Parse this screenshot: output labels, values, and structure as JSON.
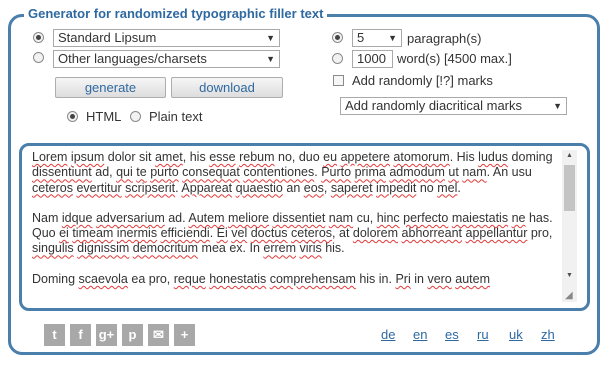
{
  "form": {
    "legend": "Generator for randomized typographic filler text",
    "source_select_1": "Standard Lipsum",
    "source_select_2": "Other languages/charsets",
    "generate_label": "generate",
    "download_label": "download",
    "format_html": "HTML",
    "format_plain": "Plain text",
    "paragraphs_value": "5",
    "paragraphs_label": "paragraph(s)",
    "words_value": "1000",
    "words_label": "word(s) [4500 max.]",
    "random_marks_label": "Add randomly [!?] marks",
    "diacritical_select": "Add randomly diacritical marks"
  },
  "output": {
    "p1": [
      {
        "t": "Lorem",
        "s": true
      },
      {
        "t": " "
      },
      {
        "t": "ipsum",
        "s": true
      },
      {
        "t": " dolor sit "
      },
      {
        "t": "amet",
        "s": true
      },
      {
        "t": ", his "
      },
      {
        "t": "esse",
        "s": true
      },
      {
        "t": " "
      },
      {
        "t": "rebum",
        "s": true
      },
      {
        "t": " no, duo "
      },
      {
        "t": "eu",
        "s": true
      },
      {
        "t": " "
      },
      {
        "t": "appetere",
        "s": true
      },
      {
        "t": " "
      },
      {
        "t": "atomorum",
        "s": true
      },
      {
        "t": ". His "
      },
      {
        "t": "ludus",
        "s": true
      },
      {
        "t": " doming "
      },
      {
        "t": "dissentiunt",
        "s": true
      },
      {
        "t": " ad, "
      },
      {
        "t": "qui",
        "s": true
      },
      {
        "t": " "
      },
      {
        "t": "te",
        "s": true
      },
      {
        "t": " "
      },
      {
        "t": "purto",
        "s": true
      },
      {
        "t": " "
      },
      {
        "t": "consequat",
        "s": true
      },
      {
        "t": " "
      },
      {
        "t": "contentiones",
        "s": true
      },
      {
        "t": ". "
      },
      {
        "t": "Purto",
        "s": true
      },
      {
        "t": " "
      },
      {
        "t": "prima",
        "s": true
      },
      {
        "t": " "
      },
      {
        "t": "admodum",
        "s": true
      },
      {
        "t": " "
      },
      {
        "t": "ut",
        "s": true
      },
      {
        "t": " "
      },
      {
        "t": "nam",
        "s": true
      },
      {
        "t": ". An usu "
      },
      {
        "t": "ceteros",
        "s": true
      },
      {
        "t": " "
      },
      {
        "t": "evertitur",
        "s": true
      },
      {
        "t": " "
      },
      {
        "t": "scripserit",
        "s": true
      },
      {
        "t": ". "
      },
      {
        "t": "Appareat",
        "s": true
      },
      {
        "t": " "
      },
      {
        "t": "quaestio",
        "s": true
      },
      {
        "t": " an "
      },
      {
        "t": "eos",
        "s": true
      },
      {
        "t": ", "
      },
      {
        "t": "saperet",
        "s": true
      },
      {
        "t": " "
      },
      {
        "t": "impedit",
        "s": true
      },
      {
        "t": " no "
      },
      {
        "t": "mel",
        "s": true
      },
      {
        "t": "."
      }
    ],
    "p2": [
      {
        "t": "Nam "
      },
      {
        "t": "idque",
        "s": true
      },
      {
        "t": " "
      },
      {
        "t": "adversarium",
        "s": true
      },
      {
        "t": " ad. "
      },
      {
        "t": "Autem",
        "s": true
      },
      {
        "t": " "
      },
      {
        "t": "meliore",
        "s": true
      },
      {
        "t": " "
      },
      {
        "t": "dissentiet",
        "s": true
      },
      {
        "t": " "
      },
      {
        "t": "nam",
        "s": true
      },
      {
        "t": " cu, "
      },
      {
        "t": "hinc",
        "s": true
      },
      {
        "t": " "
      },
      {
        "t": "perfecto",
        "s": true
      },
      {
        "t": " "
      },
      {
        "t": "maiestatis",
        "s": true
      },
      {
        "t": " "
      },
      {
        "t": "ne",
        "s": true
      },
      {
        "t": " has. Quo "
      },
      {
        "t": "ei",
        "s": true
      },
      {
        "t": " "
      },
      {
        "t": "timeam",
        "s": true
      },
      {
        "t": " "
      },
      {
        "t": "inermis",
        "s": true
      },
      {
        "t": " "
      },
      {
        "t": "efficiendi",
        "s": true
      },
      {
        "t": ". "
      },
      {
        "t": "Ei",
        "s": true
      },
      {
        "t": " "
      },
      {
        "t": "vel",
        "s": true
      },
      {
        "t": " "
      },
      {
        "t": "doctus",
        "s": true
      },
      {
        "t": " "
      },
      {
        "t": "ceteros",
        "s": true
      },
      {
        "t": ", at "
      },
      {
        "t": "dolorem",
        "s": true
      },
      {
        "t": " "
      },
      {
        "t": "abhorreant",
        "s": true
      },
      {
        "t": " "
      },
      {
        "t": "appellantur",
        "s": true
      },
      {
        "t": " pro, "
      },
      {
        "t": "singulis",
        "s": true
      },
      {
        "t": " "
      },
      {
        "t": "dignissim",
        "s": true
      },
      {
        "t": " "
      },
      {
        "t": "democritum",
        "s": true
      },
      {
        "t": " mea ex. In "
      },
      {
        "t": "errem",
        "s": true
      },
      {
        "t": " "
      },
      {
        "t": "viris",
        "s": true
      },
      {
        "t": " his."
      }
    ],
    "p3": [
      {
        "t": "Doming "
      },
      {
        "t": "scaevola",
        "s": true
      },
      {
        "t": " ea pro, "
      },
      {
        "t": "reque",
        "s": true
      },
      {
        "t": " "
      },
      {
        "t": "honestatis",
        "s": true
      },
      {
        "t": " "
      },
      {
        "t": "comprehensam",
        "s": true
      },
      {
        "t": " his in. "
      },
      {
        "t": "Pri",
        "s": true
      },
      {
        "t": " in "
      },
      {
        "t": "vero",
        "s": true
      },
      {
        "t": " "
      },
      {
        "t": "autem",
        "s": true
      }
    ]
  },
  "social": [
    {
      "icon": "twitter-icon",
      "glyph": "t"
    },
    {
      "icon": "facebook-icon",
      "glyph": "f"
    },
    {
      "icon": "google-plus-icon",
      "glyph": "g+"
    },
    {
      "icon": "pinterest-icon",
      "glyph": "p"
    },
    {
      "icon": "email-icon",
      "glyph": "✉"
    },
    {
      "icon": "more-icon",
      "glyph": "+"
    }
  ],
  "languages": [
    "de",
    "en",
    "es",
    "ru",
    "uk",
    "zh"
  ],
  "colors": {
    "accent": "#4a7fab",
    "link": "#2f69a1",
    "squiggle": "#e23a3a",
    "social": "#a8a8a8"
  }
}
